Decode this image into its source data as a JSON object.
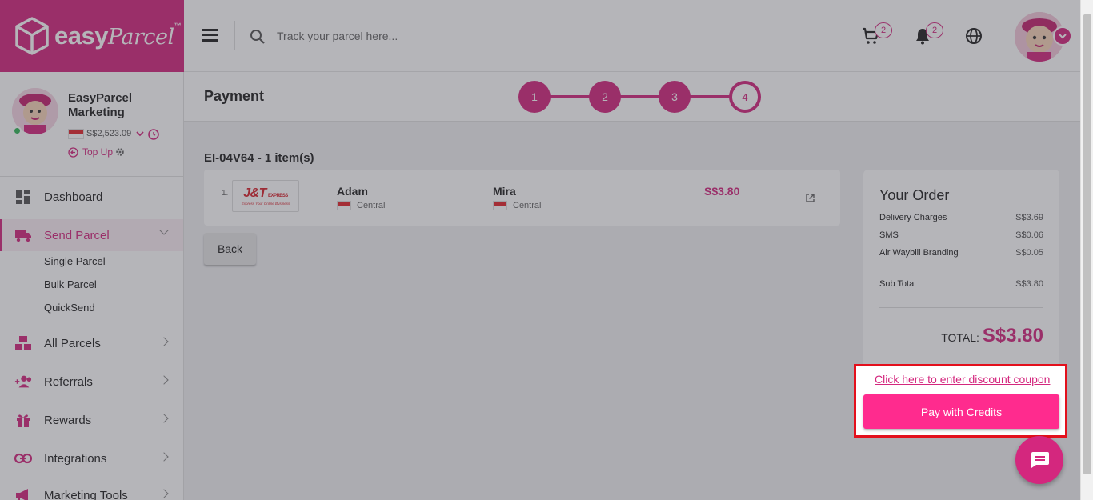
{
  "brand": {
    "logo_text": "easy",
    "logo_script": "Parcel",
    "tm": "™",
    "color": "#d4277e"
  },
  "topbar": {
    "search_placeholder": "Track your parcel here...",
    "cart_count": "2",
    "notification_count": "2"
  },
  "profile": {
    "name": "EasyParcel Marketing",
    "balance": "S$2,523.09",
    "topup_label": "Top Up",
    "status": "online"
  },
  "sidebar": {
    "items": [
      {
        "label": "Dashboard",
        "icon": "dashboard-icon"
      },
      {
        "label": "Send Parcel",
        "icon": "truck-icon",
        "active": true
      },
      {
        "label": "All Parcels",
        "icon": "boxes-icon"
      },
      {
        "label": "Referrals",
        "icon": "add-user-icon"
      },
      {
        "label": "Rewards",
        "icon": "gift-icon"
      },
      {
        "label": "Integrations",
        "icon": "link-icon"
      },
      {
        "label": "Marketing Tools",
        "icon": "megaphone-icon"
      }
    ],
    "send_parcel_sub": [
      "Single Parcel",
      "Bulk Parcel",
      "QuickSend"
    ]
  },
  "page": {
    "title": "Payment",
    "steps": [
      "1",
      "2",
      "3",
      "4"
    ],
    "current_step": 4,
    "order_id": "EI-04V64 - 1 item(s)",
    "back_label": "Back"
  },
  "parcel": {
    "index": "1.",
    "courier": "J&T",
    "courier_sub": "EXPRESS",
    "courier_tagline": "Express Your Online Business",
    "sender": "Adam",
    "sender_region": "Central",
    "receiver": "Mira",
    "receiver_region": "Central",
    "price": "S$3.80"
  },
  "summary": {
    "title": "Your Order",
    "rows": [
      {
        "label": "Delivery Charges",
        "value": "S$3.69"
      },
      {
        "label": "SMS",
        "value": "S$0.06"
      },
      {
        "label": "Air Waybill Branding",
        "value": "S$0.05"
      }
    ],
    "subtotal_label": "Sub Total",
    "subtotal_value": "S$3.80",
    "total_label": "TOTAL:",
    "total_value": "S$3.80",
    "coupon_link": "Click here to enter discount coupon",
    "pay_label": "Pay with Credits"
  },
  "colors": {
    "accent": "#d4277e",
    "pay_button": "#ff2b8e",
    "highlight": "#e3101c"
  }
}
